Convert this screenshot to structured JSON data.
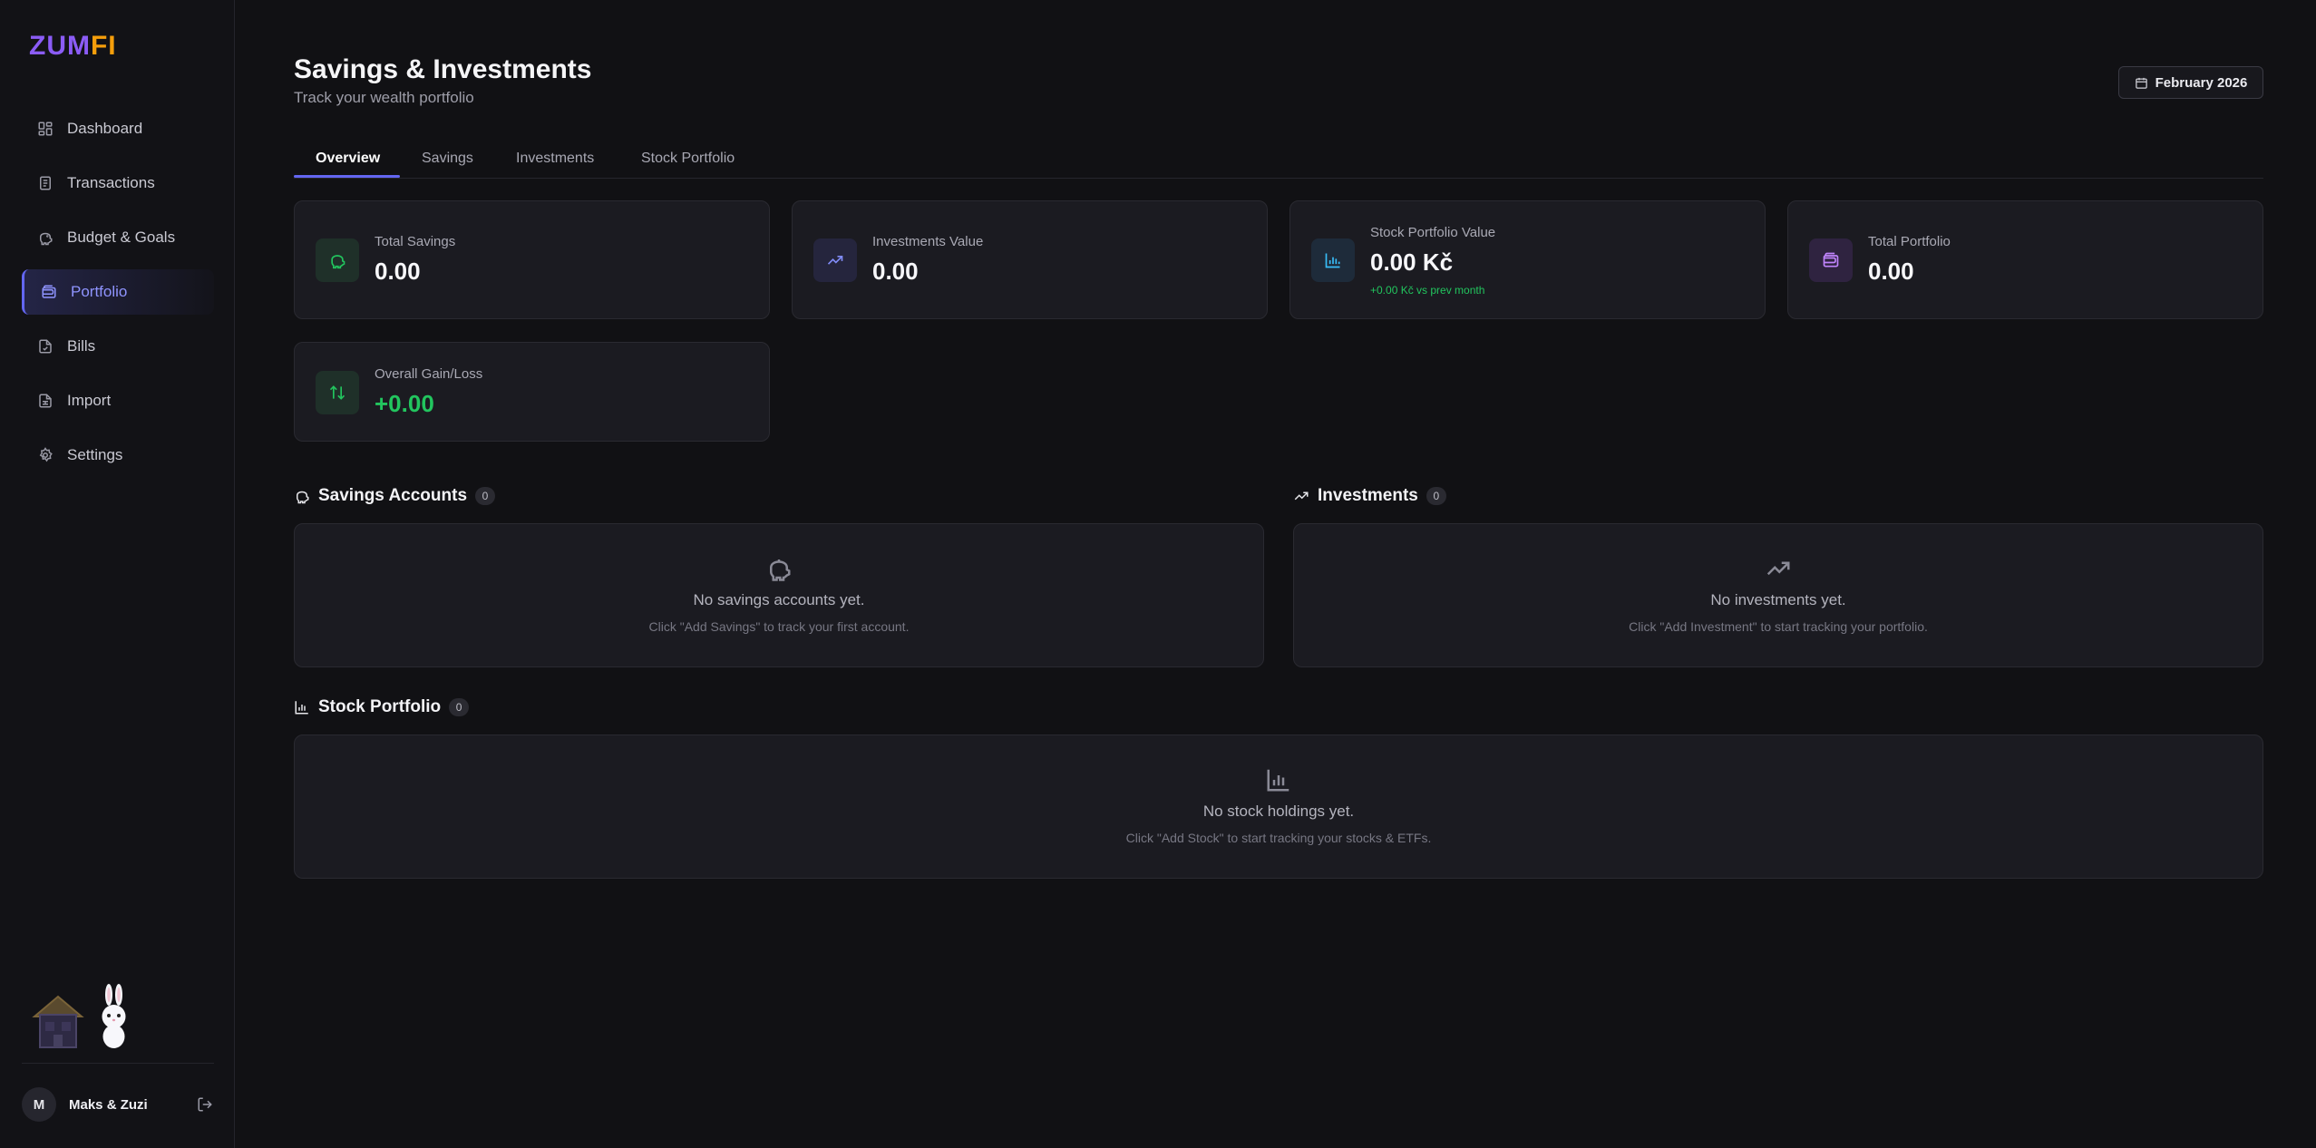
{
  "app": {
    "logo_part1": "ZUM",
    "logo_part2": "FI"
  },
  "sidebar": {
    "items": [
      {
        "label": "Dashboard",
        "icon": "dashboard-icon"
      },
      {
        "label": "Transactions",
        "icon": "receipt-icon"
      },
      {
        "label": "Budget & Goals",
        "icon": "piggy-bank-icon"
      },
      {
        "label": "Portfolio",
        "icon": "wallet-icon",
        "active": true
      },
      {
        "label": "Bills",
        "icon": "file-check-icon"
      },
      {
        "label": "Import",
        "icon": "file-spreadsheet-icon"
      },
      {
        "label": "Settings",
        "icon": "gear-icon"
      }
    ],
    "user": {
      "initial": "M",
      "name": "Maks & Zuzi"
    }
  },
  "header": {
    "title": "Savings & Investments",
    "subtitle": "Track your wealth portfolio",
    "date_button": "February 2026"
  },
  "tabs": [
    "Overview",
    "Savings",
    "Investments",
    "Stock Portfolio"
  ],
  "stats": {
    "total_savings": {
      "label": "Total Savings",
      "value": "0.00"
    },
    "investments_value": {
      "label": "Investments Value",
      "value": "0.00"
    },
    "stock_portfolio_value": {
      "label": "Stock Portfolio Value",
      "value": "0.00 Kč",
      "change": "+0.00 Kč vs prev month"
    },
    "total_portfolio": {
      "label": "Total Portfolio",
      "value": "0.00"
    },
    "overall_gain_loss": {
      "label": "Overall Gain/Loss",
      "value": "+0.00"
    }
  },
  "sections": {
    "savings": {
      "title": "Savings Accounts",
      "count": "0",
      "empty_title": "No savings accounts yet.",
      "empty_hint": "Click \"Add Savings\" to track your first account."
    },
    "investments": {
      "title": "Investments",
      "count": "0",
      "empty_title": "No investments yet.",
      "empty_hint": "Click \"Add Investment\" to start tracking your portfolio."
    },
    "stocks": {
      "title": "Stock Portfolio",
      "count": "0",
      "empty_title": "No stock holdings yet.",
      "empty_hint": "Click \"Add Stock\" to start tracking your stocks & ETFs."
    }
  },
  "colors": {
    "accent": "#6366f1",
    "positive": "#22c55e",
    "background": "#111114",
    "card": "#1b1b21"
  }
}
